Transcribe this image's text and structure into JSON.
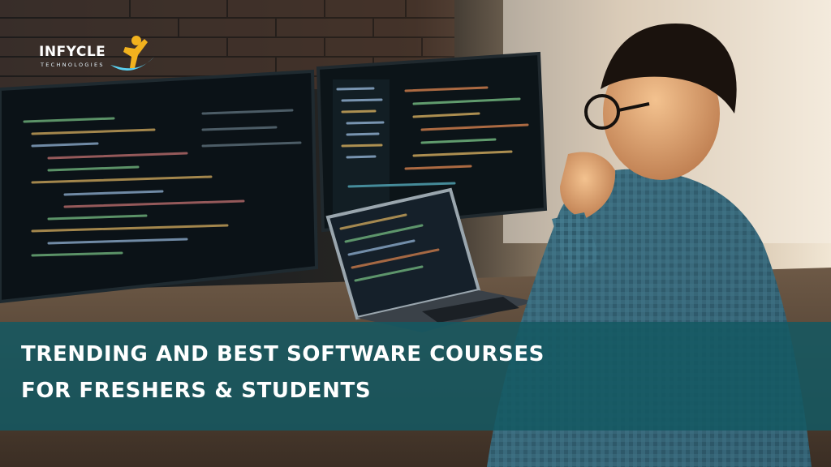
{
  "logo": {
    "brand_main": "INFYCLE",
    "brand_sub": "TECHNOLOGIES"
  },
  "banner": {
    "line1": "TRENDING AND BEST SOFTWARE COURSES",
    "line2": "FOR FRESHERS & STUDENTS"
  },
  "colors": {
    "banner_bg": "#145862",
    "banner_text": "#ffffff",
    "logo_accent": "#5ad0f0",
    "logo_figure": "#f2b21e"
  },
  "icons": [
    "logo-person-swoosh-icon"
  ]
}
